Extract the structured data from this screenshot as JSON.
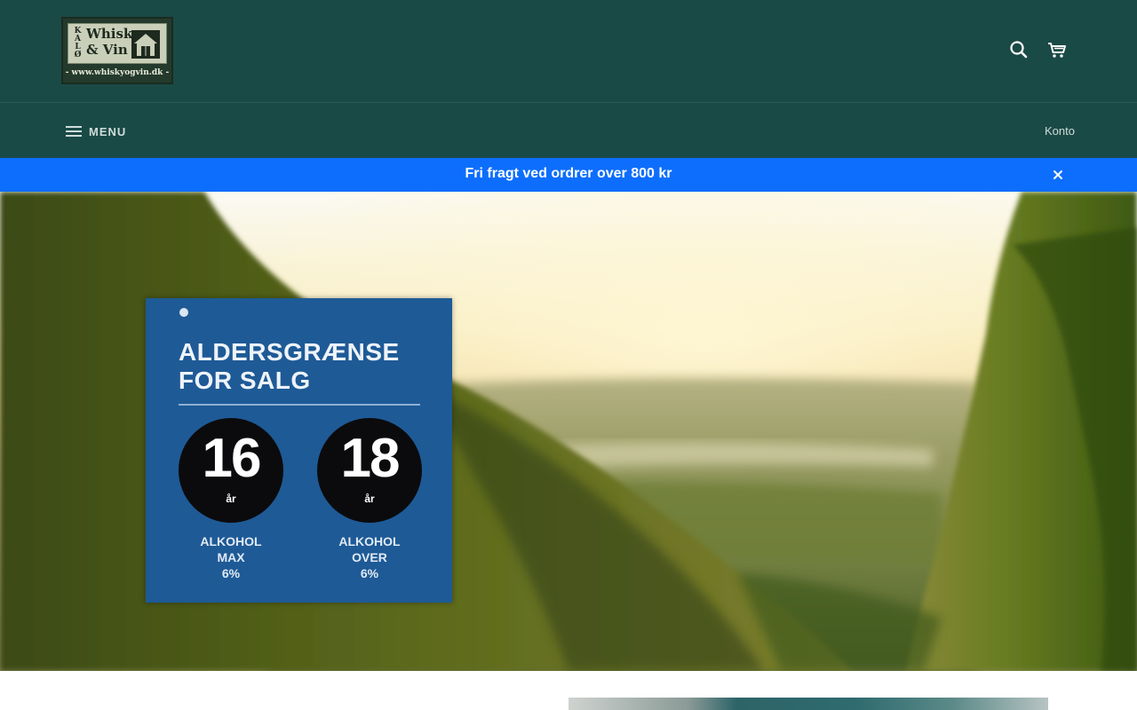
{
  "header": {
    "logo": {
      "kalo": [
        "K",
        "A",
        "L",
        "Ø"
      ],
      "line1": "Whisky",
      "line2": "& Vin",
      "url": "- www.whiskyogvin.dk -"
    },
    "icons": [
      "search-icon",
      "cart-icon"
    ]
  },
  "nav": {
    "menu_label": "MENU",
    "account_label": "Konto"
  },
  "announcement": {
    "text": "Fri fragt ved ordrer over 800 kr",
    "background": "#0d6efd"
  },
  "hero": {
    "age_card": {
      "title_line1": "ALDERSGRÆNSE",
      "title_line2": "FOR SALG",
      "badges": [
        {
          "age": "16",
          "unit": "år",
          "caption": [
            "ALKOHOL",
            "MAX",
            "6%"
          ]
        },
        {
          "age": "18",
          "unit": "år",
          "caption": [
            "ALKOHOL",
            "OVER",
            "6%"
          ]
        }
      ]
    }
  },
  "colors": {
    "header_bg": "#1a4a46",
    "nav_text": "#cfdcda",
    "card_bg": "#1e5a96"
  }
}
